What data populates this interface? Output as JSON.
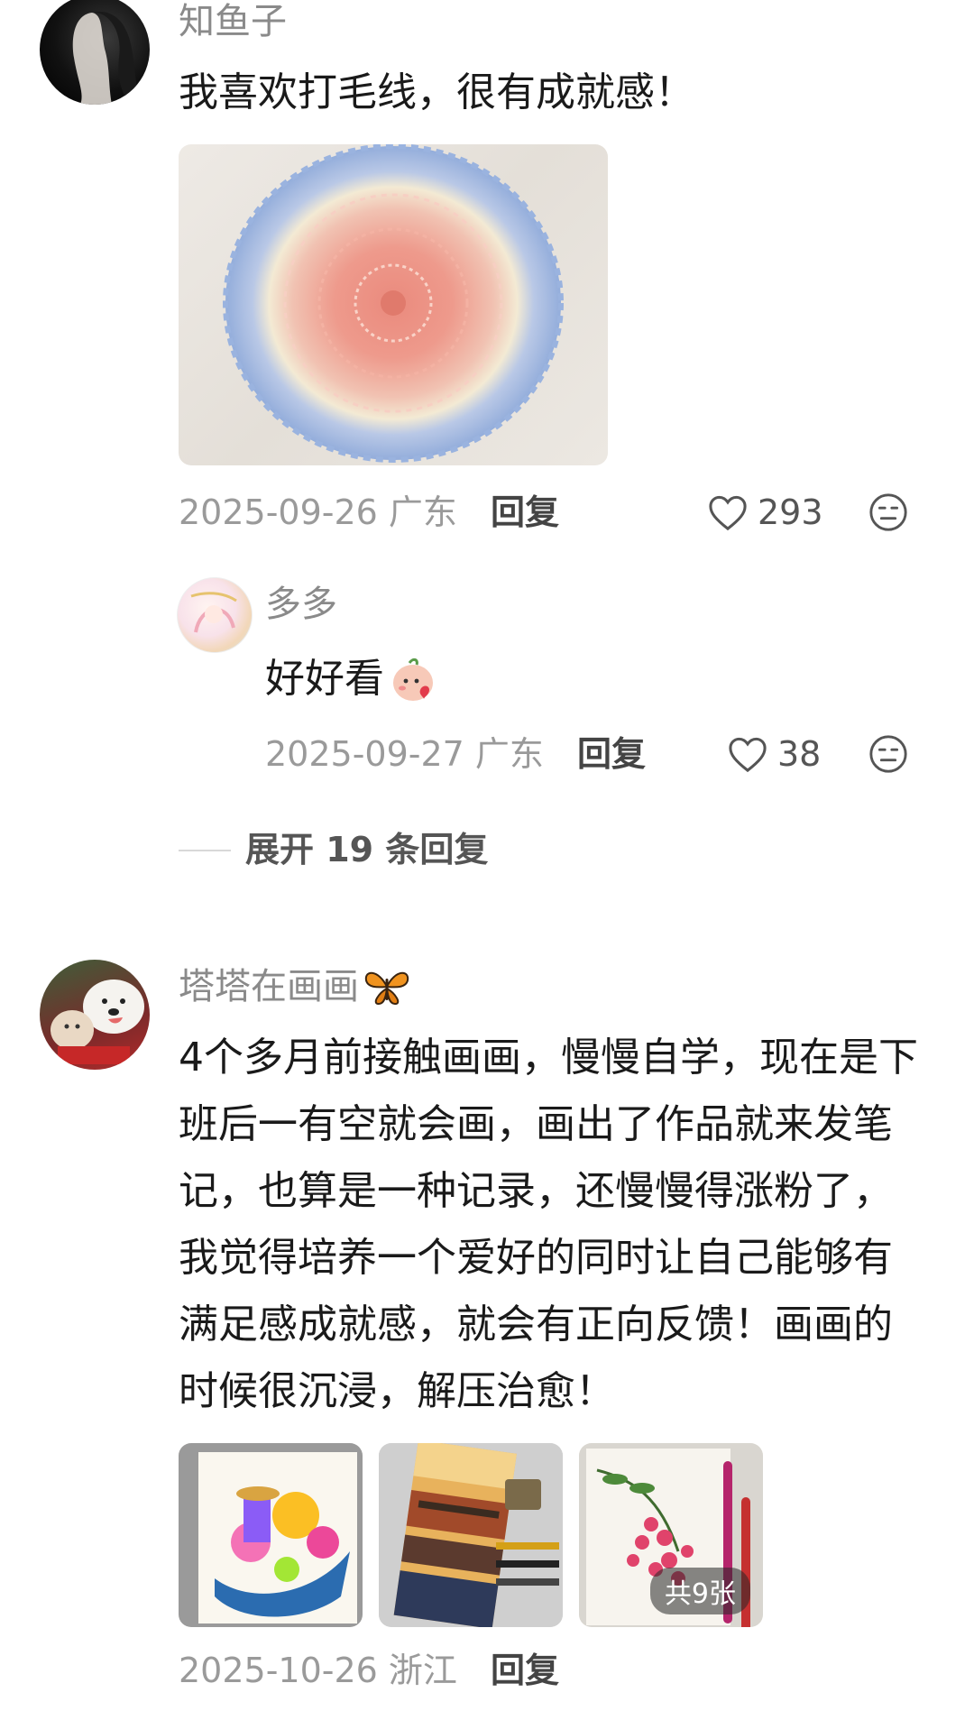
{
  "comments": [
    {
      "username": "知鱼子",
      "text": "我喜欢打毛线，很有成就感！",
      "date_location": "2025-09-26 广东",
      "reply_label": "回复",
      "likes": "293",
      "replies": [
        {
          "username": "多多",
          "text": "好好看",
          "date_location": "2025-09-27 广东",
          "reply_label": "回复",
          "likes": "38"
        }
      ],
      "expand_label": "展开 19 条回复"
    },
    {
      "username": "塔塔在画画",
      "text": "4个多月前接触画画，慢慢自学，现在是下班后一有空就会画，画出了作品就来发笔记，也算是一种记录，还慢慢得涨粉了，我觉得培养一个爱好的同时让自己能够有满足感成就感，就会有正向反馈！画画的时候很沉浸，解压治愈！",
      "images_badge": "共9张",
      "date_location": "2025-10-26 浙江",
      "reply_label": "回复"
    }
  ],
  "icons": {
    "like": "heart-outline-icon",
    "emoji": "emoji-face-icon",
    "butterfly": "butterfly-icon",
    "blush": "blush-sticker-icon"
  }
}
